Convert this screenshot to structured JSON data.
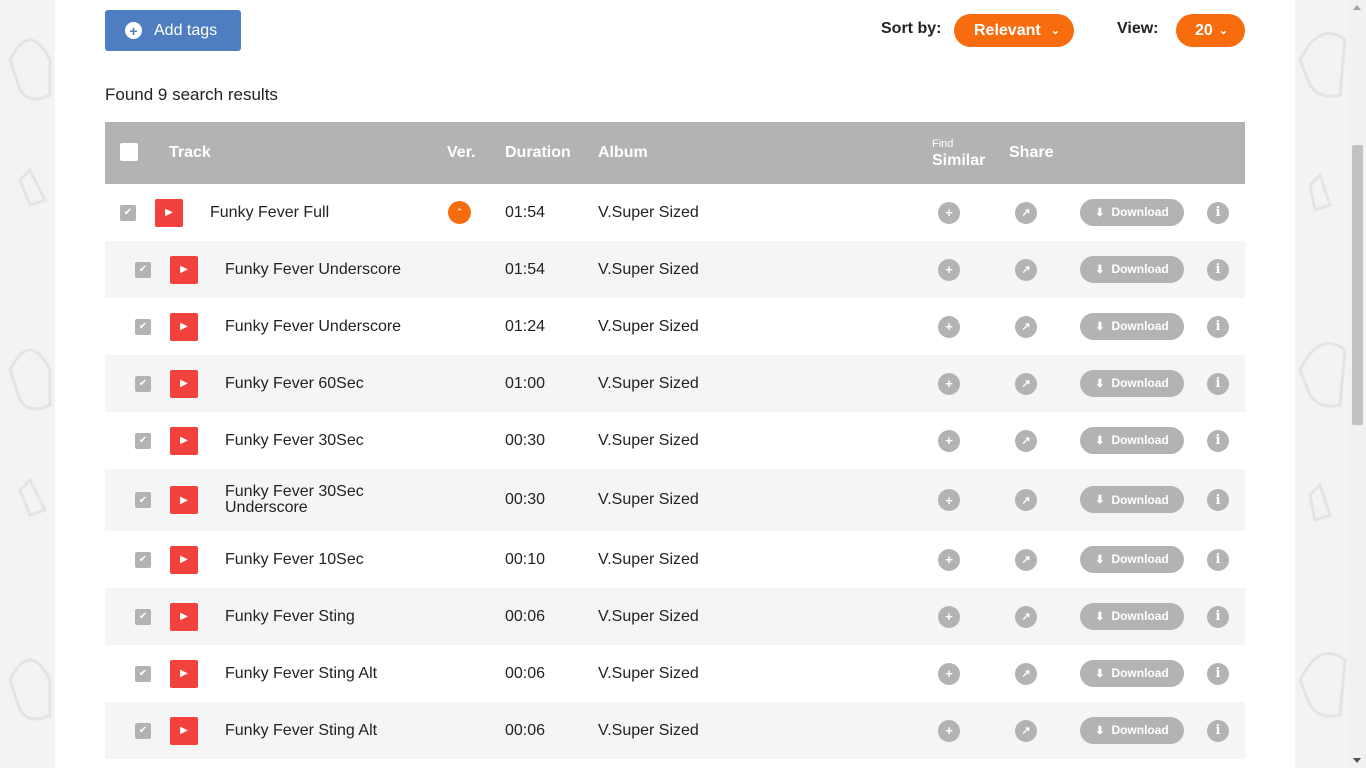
{
  "toolbar": {
    "add_tags_label": "Add tags",
    "sort_label": "Sort by:",
    "sort_value": "Relevant",
    "view_label": "View:",
    "view_value": "20"
  },
  "results_summary": "Found 9 search results",
  "table": {
    "headers": {
      "track": "Track",
      "ver": "Ver.",
      "duration": "Duration",
      "album": "Album",
      "find_small": "Find",
      "find_big": "Similar",
      "share": "Share"
    },
    "download_label": "Download",
    "rows": [
      {
        "track": "Funky Fever Full",
        "duration": "01:54",
        "album": "V.Super Sized"
      },
      {
        "track": "Funky Fever Underscore",
        "duration": "01:54",
        "album": "V.Super Sized"
      },
      {
        "track": "Funky Fever Underscore",
        "duration": "01:24",
        "album": "V.Super Sized"
      },
      {
        "track": "Funky Fever 60Sec",
        "duration": "01:00",
        "album": "V.Super Sized"
      },
      {
        "track": "Funky Fever 30Sec",
        "duration": "00:30",
        "album": "V.Super Sized"
      },
      {
        "track": "Funky Fever 30Sec",
        "track_line2": "Underscore",
        "duration": "00:30",
        "album": "V.Super Sized"
      },
      {
        "track": "Funky Fever 10Sec",
        "duration": "00:10",
        "album": "V.Super Sized"
      },
      {
        "track": "Funky Fever Sting",
        "duration": "00:06",
        "album": "V.Super Sized"
      },
      {
        "track": "Funky Fever Sting Alt",
        "duration": "00:06",
        "album": "V.Super Sized"
      },
      {
        "track": "Funky Fever Sting Alt",
        "duration": "00:06",
        "album": "V.Super Sized"
      }
    ]
  },
  "colors": {
    "accent_orange": "#f76c0f",
    "button_blue": "#4f7ec0",
    "play_red": "#f1423d",
    "header_gray": "#b3b3b3"
  },
  "icons": {
    "add_tags": "plus-circle-icon",
    "sort_dropdown": "chevron-down-icon",
    "play": "play-icon",
    "ver_toggle": "chevron-up-icon",
    "find_similar": "plus-circle-icon",
    "share": "external-link-icon",
    "download": "download-arrow-icon",
    "info": "info-icon"
  }
}
